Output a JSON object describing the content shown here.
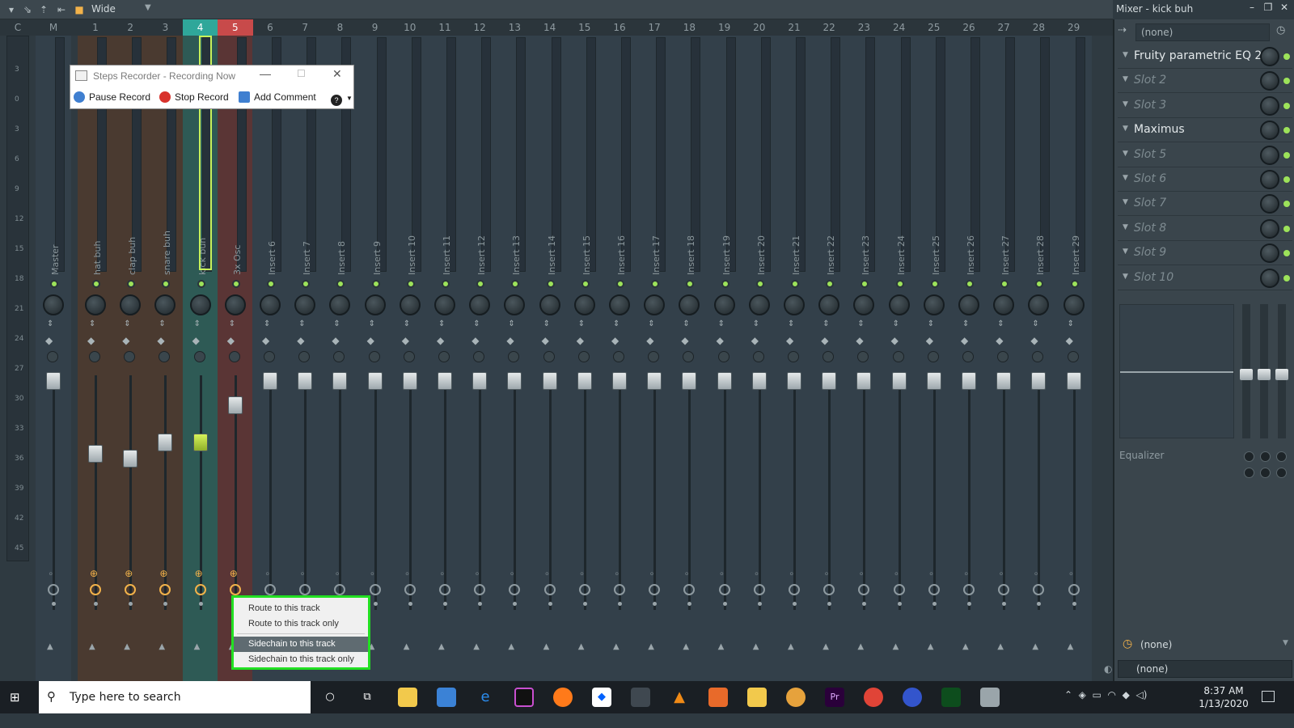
{
  "toolbar": {
    "mode": "Wide"
  },
  "mixer": {
    "title": "Mixer - kick buh",
    "header_row": [
      "C",
      "M",
      "1",
      "2",
      "3",
      "4",
      "5",
      "6",
      "7",
      "8",
      "9",
      "10",
      "11",
      "12",
      "13",
      "14",
      "15",
      "16",
      "17",
      "18",
      "19",
      "20",
      "21",
      "22",
      "23",
      "24",
      "25",
      "26",
      "27",
      "28",
      "29"
    ],
    "db_scale": [
      "3",
      "0",
      "3",
      "6",
      "9",
      "12",
      "15",
      "18",
      "21",
      "24",
      "27",
      "30",
      "33",
      "36",
      "39",
      "42",
      "45"
    ],
    "tracks": [
      {
        "name": "Master"
      },
      {
        "name": "hat buh"
      },
      {
        "name": "clap buh"
      },
      {
        "name": "snare buh"
      },
      {
        "name": "kick buh"
      },
      {
        "name": "3x Osc"
      },
      {
        "name": "Insert 6"
      },
      {
        "name": "Insert 7"
      },
      {
        "name": "Insert 8"
      },
      {
        "name": "Insert 9"
      },
      {
        "name": "Insert 10"
      },
      {
        "name": "Insert 11"
      },
      {
        "name": "Insert 12"
      },
      {
        "name": "Insert 13"
      },
      {
        "name": "Insert 14"
      },
      {
        "name": "Insert 15"
      },
      {
        "name": "Insert 16"
      },
      {
        "name": "Insert 17"
      },
      {
        "name": "Insert 18"
      },
      {
        "name": "Insert 19"
      },
      {
        "name": "Insert 20"
      },
      {
        "name": "Insert 21"
      },
      {
        "name": "Insert 22"
      },
      {
        "name": "Insert 23"
      },
      {
        "name": "Insert 24"
      },
      {
        "name": "Insert 25"
      },
      {
        "name": "Insert 26"
      },
      {
        "name": "Insert 27"
      },
      {
        "name": "Insert 28"
      },
      {
        "name": "Insert 29"
      }
    ]
  },
  "right_panel": {
    "preset": "(none)",
    "slots": [
      {
        "label": "Fruity parametric EQ 2",
        "empty": false
      },
      {
        "label": "Slot 2",
        "empty": true
      },
      {
        "label": "Slot 3",
        "empty": true
      },
      {
        "label": "Maximus",
        "empty": false
      },
      {
        "label": "Slot 5",
        "empty": true
      },
      {
        "label": "Slot 6",
        "empty": true
      },
      {
        "label": "Slot 7",
        "empty": true
      },
      {
        "label": "Slot 8",
        "empty": true
      },
      {
        "label": "Slot 9",
        "empty": true
      },
      {
        "label": "Slot 10",
        "empty": true
      }
    ],
    "eq_label": "Equalizer",
    "route_in": "(none)",
    "route_out": "(none)"
  },
  "steps_recorder": {
    "title": "Steps Recorder - Recording Now",
    "pause": "Pause Record",
    "stop": "Stop Record",
    "comment": "Add Comment",
    "help": "?"
  },
  "context_menu": {
    "items": [
      "Route to this track",
      "Route to this track only",
      "Sidechain to this track",
      "Sidechain to this track only"
    ],
    "highlighted_index": 2
  },
  "taskbar": {
    "search_placeholder": "Type here to search",
    "time": "8:37 AM",
    "date": "1/13/2020"
  },
  "colors": {
    "accent_green": "#22e022",
    "led_green": "#9de35a",
    "track_brown": "#4a3a30",
    "track_teal": "#2e5a55",
    "track_red": "#5a3535"
  }
}
